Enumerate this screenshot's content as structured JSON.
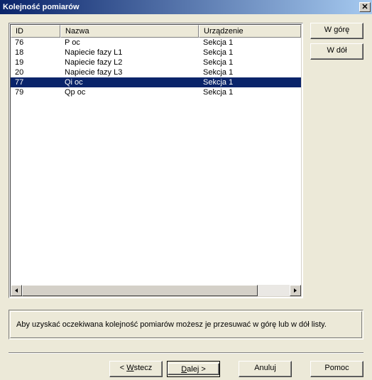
{
  "title": "Kolejność pomiarów",
  "columns": {
    "id": "ID",
    "name": "Nazwa",
    "device": "Urządzenie"
  },
  "rows": [
    {
      "id": "76",
      "name": "P oc",
      "device": "Sekcja 1",
      "selected": false
    },
    {
      "id": "18",
      "name": "Napiecie fazy L1",
      "device": "Sekcja 1",
      "selected": false
    },
    {
      "id": "19",
      "name": "Napiecie fazy L2",
      "device": "Sekcja 1",
      "selected": false
    },
    {
      "id": "20",
      "name": "Napiecie fazy L3",
      "device": "Sekcja 1",
      "selected": false
    },
    {
      "id": "77",
      "name": "Qi oc",
      "device": "Sekcja 1",
      "selected": true
    },
    {
      "id": "79",
      "name": "Qp oc",
      "device": "Sekcja 1",
      "selected": false
    }
  ],
  "buttons": {
    "up": "W górę",
    "down": "W dół",
    "back_pre": "< ",
    "back_u": "W",
    "back_post": "stecz",
    "next_u": "D",
    "next_post": "alej >",
    "cancel": "Anuluj",
    "help": "Pomoc"
  },
  "hint": "Aby uzyskać oczekiwana kolejność pomiarów możesz je przesuwać w górę lub w dół listy.",
  "close_glyph": "✕"
}
